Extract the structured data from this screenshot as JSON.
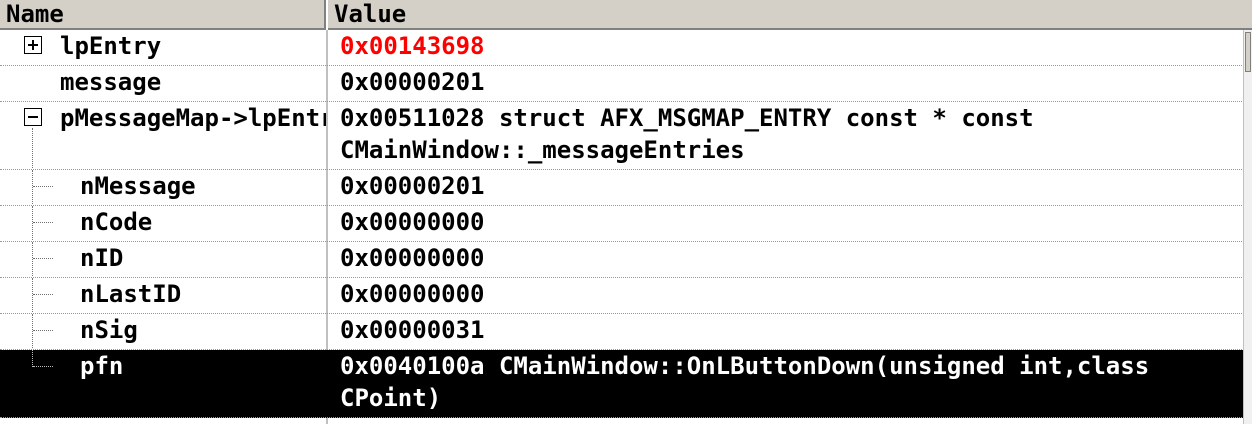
{
  "header": {
    "name_label": "Name",
    "value_label": "Value"
  },
  "rows": [
    {
      "name": "lpEntry",
      "value": "0x00143698",
      "value_changed": true,
      "expander": "plus"
    },
    {
      "name": "message",
      "value": "0x00000201"
    },
    {
      "name": "pMessageMap->lpEntries",
      "value": "0x00511028 struct AFX_MSGMAP_ENTRY const * const\nCMainWindow::_messageEntries",
      "expander": "minus"
    },
    {
      "name": "nMessage",
      "value": "0x00000201"
    },
    {
      "name": "nCode",
      "value": "0x00000000"
    },
    {
      "name": "nID",
      "value": "0x00000000"
    },
    {
      "name": "nLastID",
      "value": "0x00000000"
    },
    {
      "name": "nSig",
      "value": "0x00000031"
    },
    {
      "name": "pfn",
      "value": "0x0040100a CMainWindow::OnLButtonDown(unsigned int,class\nCPoint)",
      "selected": true
    }
  ],
  "colors": {
    "changed_value": "#ff0000",
    "selection_bg": "#000000",
    "header_bg": "#d4d0c8"
  }
}
